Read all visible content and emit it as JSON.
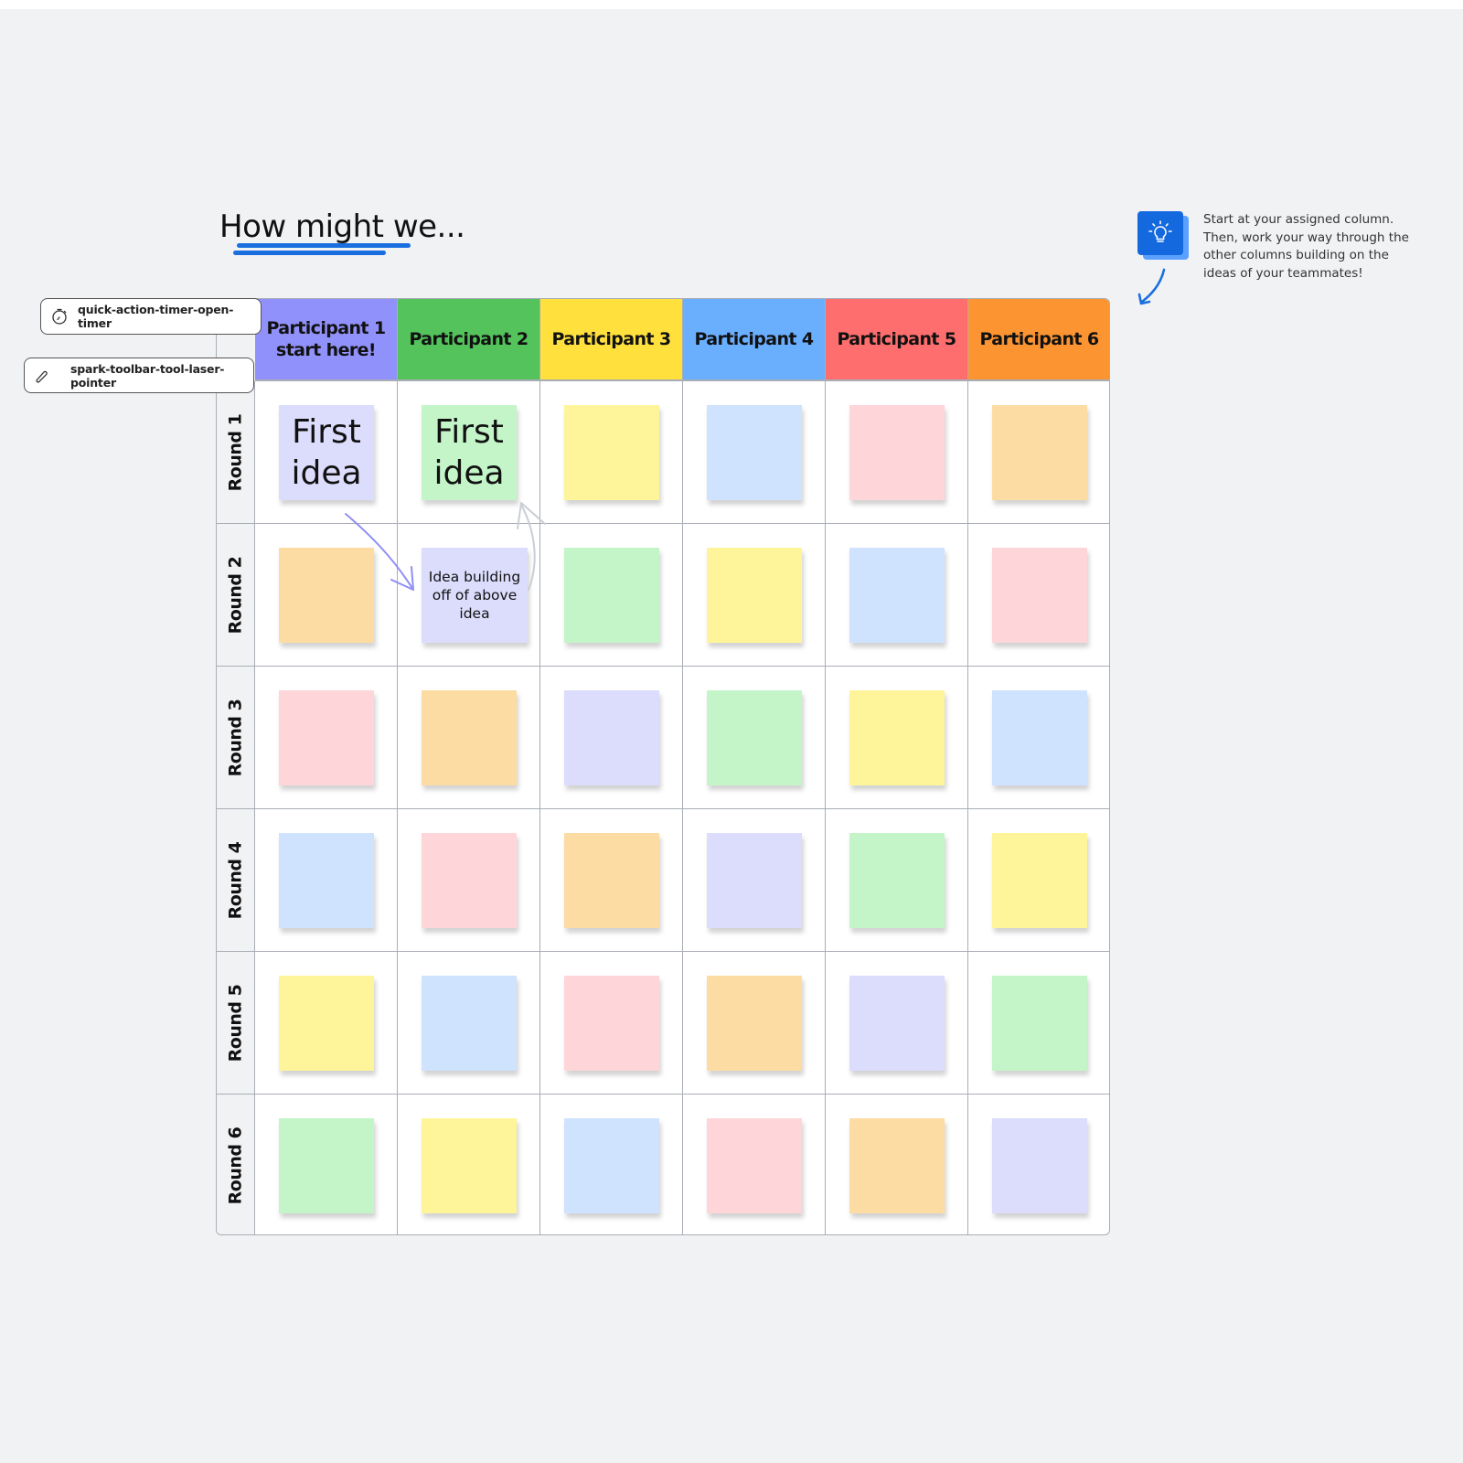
{
  "title": "How might we...",
  "tip": {
    "icon": "lightbulb-icon",
    "text": "Start at your assigned column. Then, work your way through the other columns building on the ideas of your teammates!"
  },
  "chips": [
    {
      "label": "quick-action-timer-open-timer",
      "icon": "timer-icon"
    },
    {
      "label": "spark-toolbar-tool-laser-pointer",
      "icon": "laser-pointer-icon"
    }
  ],
  "columns": [
    {
      "label": "Participant 1 start here!",
      "color": "#9191fb"
    },
    {
      "label": "Participant 2",
      "color": "#54c35c"
    },
    {
      "label": "Participant 3",
      "color": "#ffe03d"
    },
    {
      "label": "Participant 4",
      "color": "#6aaefe"
    },
    {
      "label": "Participant 5",
      "color": "#ff6e6e"
    },
    {
      "label": "Participant 6",
      "color": "#fd9432"
    }
  ],
  "rows": [
    "Round 1",
    "Round 2",
    "Round 3",
    "Round 4",
    "Round 5",
    "Round 6"
  ],
  "sticky_colors": {
    "violet": "#dcdcfc",
    "green": "#c3f5c8",
    "yellow": "#fef59b",
    "blue": "#cfe2fe",
    "pink": "#fed5d9",
    "orange": "#fddca3"
  },
  "grid": [
    [
      {
        "c": "violet",
        "text": "First idea",
        "size": "big"
      },
      {
        "c": "green",
        "text": "First idea",
        "size": "big"
      },
      {
        "c": "yellow"
      },
      {
        "c": "blue"
      },
      {
        "c": "pink"
      },
      {
        "c": "orange"
      }
    ],
    [
      {
        "c": "orange"
      },
      {
        "c": "violet",
        "text": "Idea building off of above idea",
        "size": "small"
      },
      {
        "c": "green"
      },
      {
        "c": "yellow"
      },
      {
        "c": "blue"
      },
      {
        "c": "pink"
      }
    ],
    [
      {
        "c": "pink"
      },
      {
        "c": "orange"
      },
      {
        "c": "violet"
      },
      {
        "c": "green"
      },
      {
        "c": "yellow"
      },
      {
        "c": "blue"
      }
    ],
    [
      {
        "c": "blue"
      },
      {
        "c": "pink"
      },
      {
        "c": "orange"
      },
      {
        "c": "violet"
      },
      {
        "c": "green"
      },
      {
        "c": "yellow"
      }
    ],
    [
      {
        "c": "yellow"
      },
      {
        "c": "blue"
      },
      {
        "c": "pink"
      },
      {
        "c": "orange"
      },
      {
        "c": "violet"
      },
      {
        "c": "green"
      }
    ],
    [
      {
        "c": "green"
      },
      {
        "c": "yellow"
      },
      {
        "c": "blue"
      },
      {
        "c": "pink"
      },
      {
        "c": "orange"
      },
      {
        "c": "violet"
      }
    ]
  ]
}
